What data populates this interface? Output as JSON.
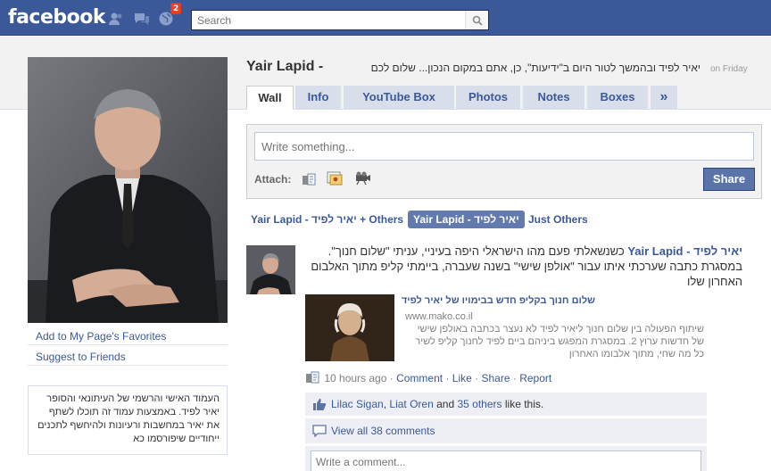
{
  "topbar": {
    "logo": "facebook",
    "notifications_count": "2",
    "search_placeholder": "Search"
  },
  "profile": {
    "name": "Yair Lapid -",
    "status_text": "יאיר לפיד ובהמשך לטור היום ב\"ידיעות\", כן, אתם במקום הנכון... שלום לכם",
    "status_time": "on Friday",
    "left_links": [
      "Add to My Page's Favorites",
      "Suggest to Friends"
    ],
    "bio": "העמוד האישי והרשמי של העיתונאי והסופר יאיר לפיד. באמצעות עמוד זה תוכלו לשתף את יאיר במחשבות ורעיונות ולהיחשף לתכנים ייחודיים שיפורסמו כא"
  },
  "tabs": [
    "Wall",
    "Info",
    "YouTube Box",
    "Photos",
    "Notes",
    "Boxes"
  ],
  "tabs_more": "»",
  "publisher": {
    "placeholder": "Write something...",
    "attach_label": "Attach:",
    "share_label": "Share"
  },
  "filters": [
    "Yair Lapid - יאיר לפיד + Others",
    "Yair Lapid - יאיר לפיד",
    "Just Others"
  ],
  "story": {
    "actor_he": "יאיר לפיד",
    "actor_en": "Yair Lapid -",
    "text": "כשנשאלתי פעם מהו הישראלי היפה בעיניי, עניתי \"שלום חנוך\". במסגרת כתבה שערכתי איתו עבור \"אולפן שישי\" בשנה שעברה, ביימתי קליפ מתוך האלבום האחרון שלו",
    "attachment": {
      "title": "שלום חנוך בקליפ חדש בבימויו של יאיר לפיד",
      "domain": "www.mako.co.il",
      "description": "שיתוף הפעולה בין שלום חנוך ליאיר לפיד לא נעצר בכתבה באולפן שישי של חדשות ערוץ 2. במסגרת המפגש ביניהם ביים לפיד לחנוך קליפ לשיר כל מה שחי, מתוך אלבומו האחרון"
    },
    "time": "10 hours ago",
    "actions": [
      "Comment",
      "Like",
      "Share",
      "Report"
    ],
    "likes": {
      "names": [
        "Lilac Sigan",
        "Liat Oren"
      ],
      "and": "and",
      "others": "35 others",
      "suffix": "like this."
    },
    "view_comments": "View all 38 comments",
    "comment_placeholder": "Write a comment..."
  },
  "colors": {
    "brand_blue": "#3b5998",
    "topbar_dark": "#29447e",
    "tab_bg": "#d8dfea",
    "ufi_bg": "#edeff4",
    "badge_red": "#f03d25"
  }
}
